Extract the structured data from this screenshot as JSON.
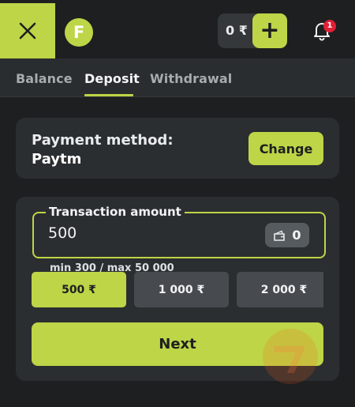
{
  "header": {
    "logo_letter": "F",
    "balance_text": "0 ₹",
    "notification_count": "1"
  },
  "tabs": [
    {
      "label": "Balance"
    },
    {
      "label": "Deposit",
      "active": true
    },
    {
      "label": "Withdrawal"
    }
  ],
  "payment": {
    "label": "Payment method:",
    "value": "Paytm",
    "change_label": "Change"
  },
  "amount": {
    "legend": "Transaction amount",
    "value": "500",
    "wallet_count": "0",
    "limits": "min 300 / max 50 000"
  },
  "quick_amounts": [
    {
      "label": "500 ₹",
      "selected": true
    },
    {
      "label": "1 000 ₹"
    },
    {
      "label": "2 000 ₹"
    }
  ],
  "next_label": "Next",
  "colors": {
    "accent": "#bdd547",
    "background": "#1d1f20",
    "card": "#2b2e30",
    "badge": "#e21f35"
  },
  "icons": {
    "close": "close-icon",
    "add": "plus-icon",
    "bell": "bell-icon",
    "wallet": "wallet-icon"
  }
}
